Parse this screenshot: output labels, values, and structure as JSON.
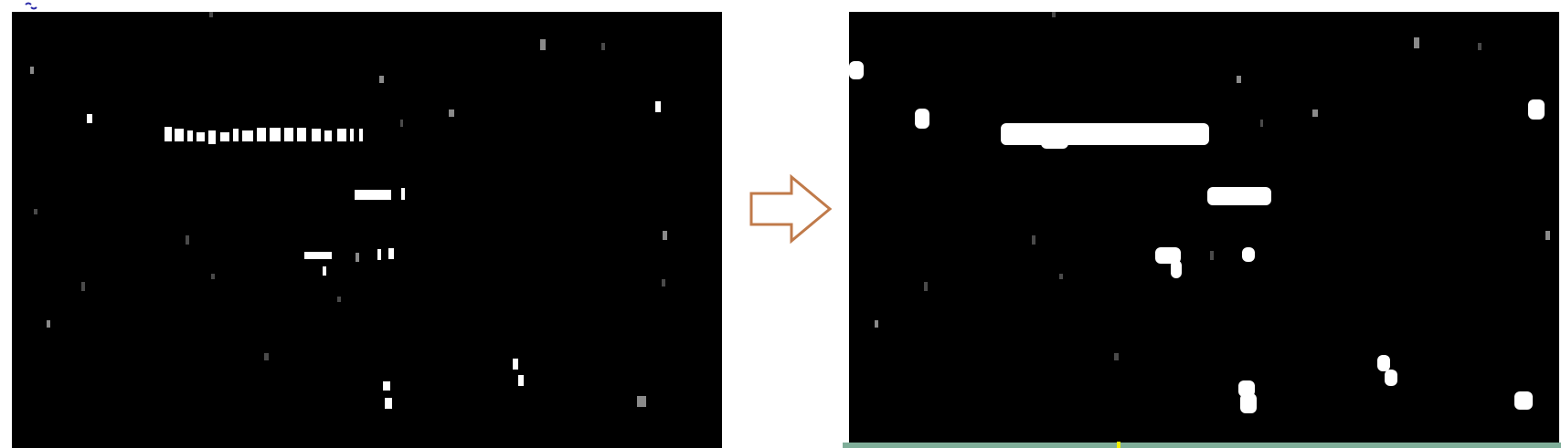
{
  "panels": {
    "left": {
      "name": "original-noisy-image"
    },
    "right": {
      "name": "processed-dilated-image"
    }
  },
  "arrow": {
    "icon": "right-arrow-outline-icon",
    "color": "#c07a4a"
  },
  "colors": {
    "background": "#000000",
    "foreground": "#ffffff",
    "strip": "#7fae99",
    "marker": "#f3f000"
  }
}
